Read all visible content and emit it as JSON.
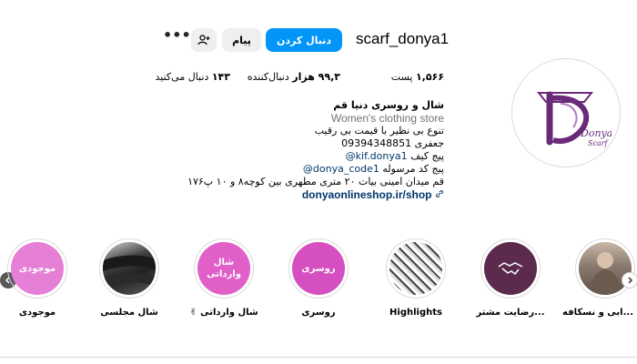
{
  "profile": {
    "username": "scarf_donya1",
    "follow_label": "دنبال کردن",
    "message_label": "پیام",
    "adduser_icon": "add-user-icon",
    "more_label": "•••",
    "posts_num": "۱,۵۶۶",
    "posts_label": "پست",
    "followers_num": "۹۹,۳ هزار",
    "followers_label": "دنبال‌کننده",
    "following_num": "۱۴۳",
    "following_label": "دنبال می‌کنید",
    "logo_text": "Donya",
    "logo_subtext": "Scarf"
  },
  "bio": {
    "name": "شال و روسری دنیا قم",
    "category": "Women's clothing store",
    "line1": "تنوع بی نظیر با قیمت بی رقیب",
    "line2": "جعفری 09394348851",
    "line3_prefix": "پیج کیف",
    "line3_link": "@kif.donya1",
    "line4_prefix": "پیج کد مرسوله",
    "line4_link": "@donya_code1",
    "line5": "قم میدان امینی بیات ۲۰ متری مطهری بین کوچه۸ و ۱۰ پ۱۷۶",
    "website": "donyaonlineshop.ir/shop"
  },
  "highlights": [
    {
      "label": "...ابی و نسکافه",
      "cover_text": "",
      "color": "#8a7a6e"
    },
    {
      "label": "...رضایت مشتر",
      "cover_text": "",
      "color": "#5b2a4d"
    },
    {
      "label": "Highlights",
      "cover_text": "",
      "color": "#555555"
    },
    {
      "label": "روسری",
      "cover_text": "روسری",
      "color": "#d64fc0"
    },
    {
      "label": "شال وارداتی ✌",
      "cover_text": "شال وارداتی",
      "color": "#e060c8"
    },
    {
      "label": "شال مجلسی",
      "cover_text": "",
      "color": "#333333"
    },
    {
      "label": "موجودی",
      "cover_text": "موجودی",
      "color": "#e67fd6"
    }
  ],
  "colors": {
    "accent": "#0095f6",
    "brand": "#6a2a7a"
  }
}
